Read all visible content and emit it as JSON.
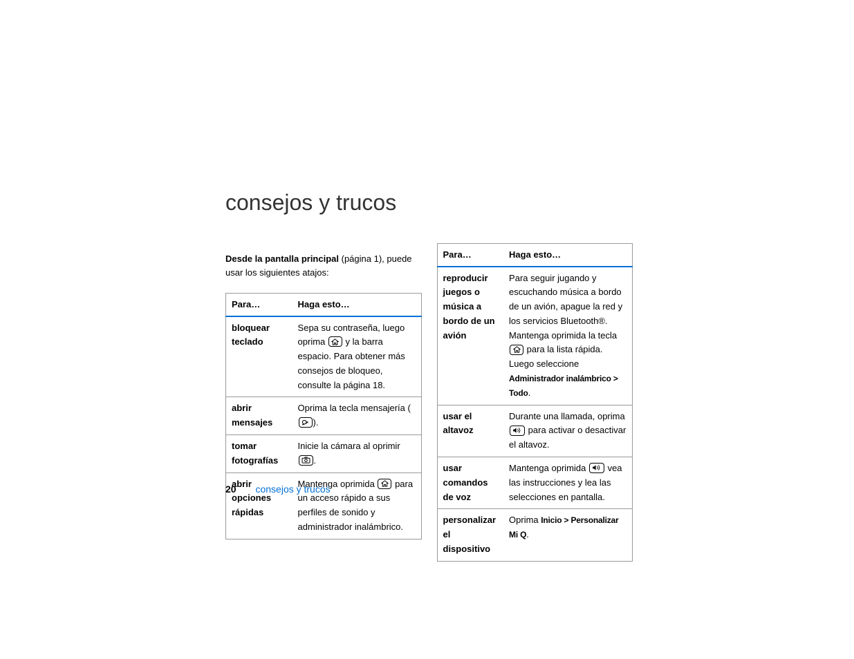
{
  "title": "consejos y trucos",
  "intro": {
    "bold": "Desde la pantalla principal",
    "rest": " (página 1), puede usar los siguientes atajos:"
  },
  "headers": {
    "para": "Para…",
    "haga": "Haga esto…"
  },
  "left": [
    {
      "para": "bloquear teclado",
      "before": "Sepa su contraseña, luego oprima ",
      "icon": "home",
      "after": " y la barra espacio. Para obtener más consejos de bloqueo, consulte la página 18."
    },
    {
      "para": "abrir mensajes",
      "before": "Oprima la tecla mensajería (",
      "icon": "message",
      "after": ")."
    },
    {
      "para": "tomar fotografías",
      "before": "Inicie la cámara al oprimir ",
      "icon": "camera",
      "after": "."
    },
    {
      "para": "abrir opciones rápidas",
      "before": "Mantenga oprimida ",
      "icon": "home",
      "after": " para un acceso rápido a sus perfiles de sonido y administrador inalámbrico."
    }
  ],
  "right": [
    {
      "para": "reproducir juegos o música a bordo de un avión",
      "before": "Para seguir jugando y escuchando música a bordo de un avión, apague la red y los servicios Bluetooth®. Mantenga oprimida la tecla ",
      "icon": "home",
      "after": " para la lista rápida. Luego seleccione ",
      "cond": "Administrador inalámbrico > Todo",
      "tail": "."
    },
    {
      "para": "usar el altavoz",
      "before": "Durante una llamada, oprima ",
      "icon": "speaker",
      "after": " para activar o desactivar el altavoz."
    },
    {
      "para": "usar comandos de voz",
      "before": "Mantenga oprimida ",
      "icon": "speaker",
      "after": " vea las instrucciones y lea las selecciones en pantalla."
    },
    {
      "para": "personalizar el dispositivo",
      "before": "Oprima ",
      "cond": "Inicio > Personalizar Mi Q",
      "tail": "."
    }
  ],
  "footer": {
    "num": "20",
    "title": "consejos y trucos"
  }
}
